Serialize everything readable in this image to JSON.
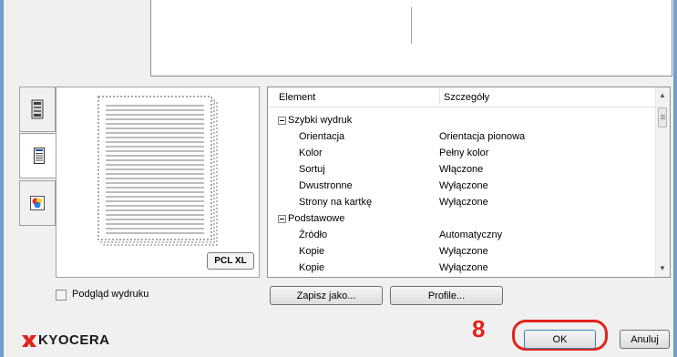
{
  "tree": {
    "header": {
      "element": "Element",
      "details": "Szczegóły"
    },
    "rows": [
      {
        "group": true,
        "label": "Szybki wydruk",
        "value": ""
      },
      {
        "group": false,
        "label": "Orientacja",
        "value": "Orientacja pionowa"
      },
      {
        "group": false,
        "label": "Kolor",
        "value": "Pełny kolor"
      },
      {
        "group": false,
        "label": "Sortuj",
        "value": "Włączone"
      },
      {
        "group": false,
        "label": "Dwustronne",
        "value": "Wyłączone"
      },
      {
        "group": false,
        "label": "Strony na kartkę",
        "value": "Wyłączone"
      },
      {
        "group": true,
        "label": "Podstawowe",
        "value": ""
      },
      {
        "group": false,
        "label": "Źródło",
        "value": "Automatyczny"
      },
      {
        "group": false,
        "label": "Kopie",
        "value": "Wyłączone"
      },
      {
        "group": false,
        "label": "Kopie",
        "value": "Wyłączone"
      }
    ]
  },
  "preview": {
    "pcl_label": "PCL XL"
  },
  "side_tabs": [
    {
      "icon": "printer-icon"
    },
    {
      "icon": "document-icon"
    },
    {
      "icon": "color-icon"
    }
  ],
  "print_preview_label": "Podgląd wydruku",
  "buttons": {
    "save_as": "Zapisz jako...",
    "profile": "Profile...",
    "ok": "OK",
    "cancel": "Anuluj"
  },
  "brand": {
    "name": "KYOCERA",
    "color": "#e2231a"
  },
  "annotation": {
    "step": "8",
    "color": "#e2231a"
  }
}
